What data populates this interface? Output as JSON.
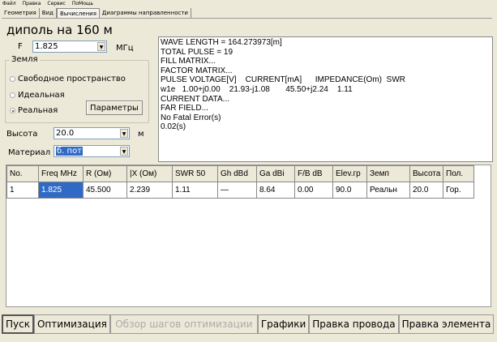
{
  "menu": [
    "Файл",
    "Правка",
    "Сервис",
    "ПоМощь"
  ],
  "tabs": [
    {
      "label": "Геометрия"
    },
    {
      "label": "Вид"
    },
    {
      "label": "Вычисления"
    },
    {
      "label": "Диаграммы направленности"
    }
  ],
  "title": "диполь на 160 м",
  "freq": {
    "label": "F",
    "value": "1.825",
    "unit": "МГц"
  },
  "ground": {
    "title": "Земля",
    "options": [
      "Свободное пространство",
      "Идеальная",
      "Реальная"
    ],
    "selected": "Реальная",
    "params_button": "Параметры"
  },
  "height": {
    "label": "Высота",
    "value": "20.0",
    "unit": "м"
  },
  "material": {
    "label": "Материал",
    "value": "б. пот"
  },
  "output_lines": [
    "WAVE LENGTH = 164.273973[m]",
    "TOTAL PULSE = 19",
    "FILL MATRIX...",
    "FACTOR MATRIX...",
    "PULSE VOLTAGE[V]    CURRENT[mA]      IMPEDANCE(Om)  SWR",
    "w1e   1.00+j0.00    21.93-j1.08       45.50+j2.24    1.11",
    "CURRENT DATA...",
    "FAR FIELD...",
    "No Fatal Error(s)",
    "0.02(s)"
  ],
  "table": {
    "headers": [
      "No.",
      "Freq MHz",
      "R (Ом)",
      "|X (Ом)",
      "SWR 50",
      "Gh dBd",
      "Ga dBi",
      "F/B dB",
      "Elev.гр",
      "Земп",
      "Высота",
      "Пол."
    ],
    "rows": [
      [
        "1",
        "1.825",
        "45.500",
        "2.239",
        "1.11",
        "—",
        "8.64",
        "0.00",
        "90.0",
        "Реальн",
        "20.0",
        "Гор."
      ]
    ]
  },
  "buttons": [
    {
      "label": "Пуск",
      "enabled": true
    },
    {
      "label": "Оптимизация",
      "enabled": true
    },
    {
      "label": "Обзор шагов оптимизации",
      "enabled": false
    },
    {
      "label": "Графики",
      "enabled": true
    },
    {
      "label": "Правка провода",
      "enabled": true
    },
    {
      "label": "Правка элемента",
      "enabled": true
    }
  ]
}
